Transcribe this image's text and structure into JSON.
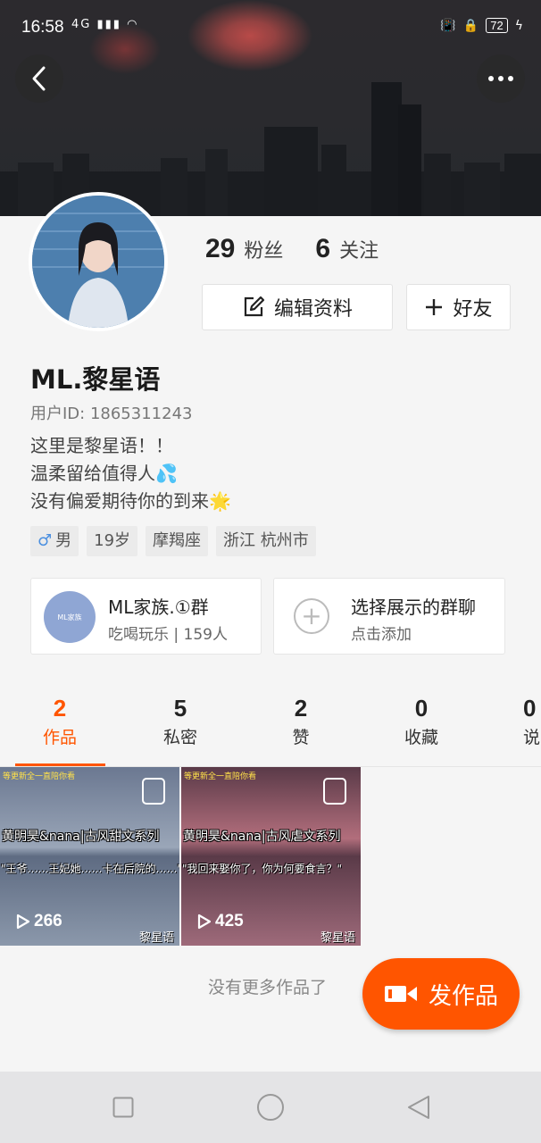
{
  "status_bar": {
    "time": "16:58",
    "left_icons": "4G",
    "battery": "72"
  },
  "profile": {
    "followers_count": "29",
    "followers_label": "粉丝",
    "following_count": "6",
    "following_label": "关注",
    "edit_button": "编辑资料",
    "friend_button": "好友",
    "username": "ML.黎星语",
    "user_id": "用户ID: 1865311243",
    "bio": [
      "这里是黎星语！！",
      "温柔留给值得人💦",
      "没有偏爱期待你的到来🌟"
    ],
    "tags": {
      "gender_symbol": "♂",
      "gender": "男",
      "age": "19岁",
      "zodiac": "摩羯座",
      "location": "浙江 杭州市"
    }
  },
  "groups": {
    "group1_icon_text": "ML家族",
    "group1_title": "ML家族.①群",
    "group1_sub": "吃喝玩乐 | 159人",
    "group2_title": "选择展示的群聊",
    "group2_sub": "点击添加"
  },
  "tabs": [
    {
      "count": "2",
      "label": "作品"
    },
    {
      "count": "5",
      "label": "私密"
    },
    {
      "count": "2",
      "label": "赞"
    },
    {
      "count": "0",
      "label": "收藏"
    },
    {
      "count": "0",
      "label": "说"
    }
  ],
  "videos": [
    {
      "top_text": "等更新全一直陪你看",
      "title": "黄明昊&nana|古风甜文系列",
      "caption": "\"王爷……王妃她……卡在后院的……\"",
      "plays": "266",
      "author": "黎星语"
    },
    {
      "top_text": "等更新全一直陪你看",
      "title": "黄明昊&nana|古风虐文系列",
      "caption": "\"我回来娶你了，你为何要食言？\"",
      "plays": "425",
      "author": "黎星语"
    }
  ],
  "footer": {
    "no_more": "没有更多作品了",
    "post_button": "发作品"
  },
  "colors": {
    "accent": "#ff5500",
    "male_blue": "#4a8fe0"
  }
}
